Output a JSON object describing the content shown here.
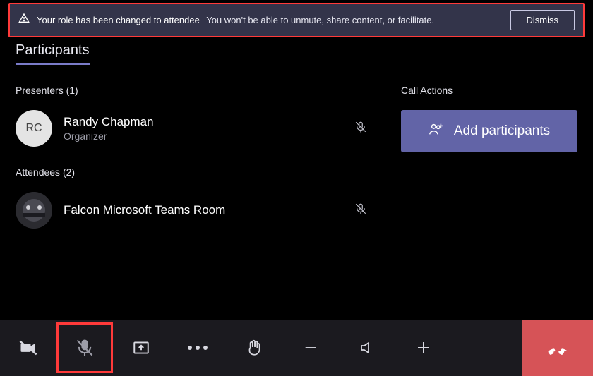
{
  "notification": {
    "strong": "Your role has been changed to attendee",
    "detail": "You won't be able to unmute, share content, or facilitate.",
    "dismiss": "Dismiss"
  },
  "tab_title": "Participants",
  "call_actions_label": "Call Actions",
  "add_participants_label": "Add participants",
  "presenters": {
    "heading": "Presenters (1)",
    "items": [
      {
        "initials": "RC",
        "name": "Randy Chapman",
        "role": "Organizer",
        "muted": true
      }
    ]
  },
  "attendees": {
    "heading": "Attendees (2)",
    "items": [
      {
        "name": "Falcon Microsoft Teams Room",
        "muted": true
      }
    ]
  }
}
